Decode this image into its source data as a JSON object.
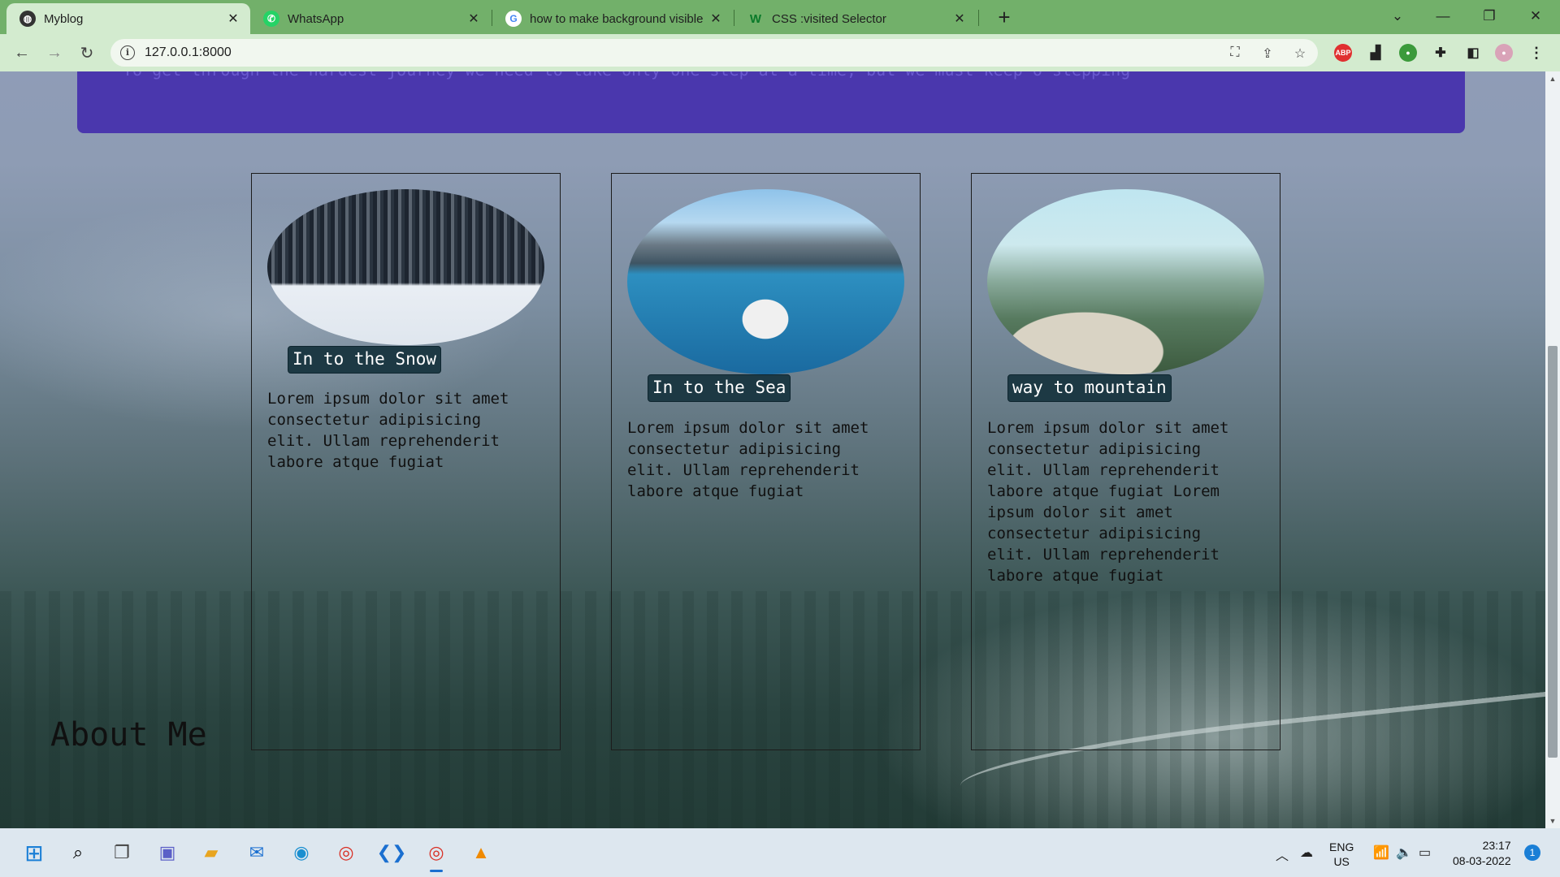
{
  "browser": {
    "tabs": [
      {
        "title": "Myblog",
        "active": true
      },
      {
        "title": "WhatsApp",
        "active": false
      },
      {
        "title": "how to make background visible",
        "active": false
      },
      {
        "title": "CSS :visited Selector",
        "active": false
      }
    ],
    "url": "127.0.0.1:8000"
  },
  "page": {
    "banner_text": "To get through the hardest journey we need to take only one step at a time, but we must keep o stepping",
    "cards": [
      {
        "title": "In to the Snow",
        "text": "Lorem ipsum dolor sit amet consectetur adipisicing elit. Ullam reprehenderit labore atque fugiat"
      },
      {
        "title": "In to the Sea",
        "text": "Lorem ipsum dolor sit amet consectetur adipisicing elit. Ullam reprehenderit labore atque fugiat"
      },
      {
        "title": "way to mountain",
        "text": "Lorem ipsum dolor sit amet consectetur adipisicing elit. Ullam reprehenderit labore atque fugiat Lorem ipsum dolor sit amet consectetur adipisicing elit. Ullam reprehenderit labore atque fugiat"
      }
    ],
    "about_heading": "About Me"
  },
  "taskbar": {
    "lang_line1": "ENG",
    "lang_line2": "US",
    "time": "23:17",
    "date": "08-03-2022",
    "notification_count": "1"
  },
  "colors": {
    "tabstrip": "#72b06a",
    "toolbar": "#d3ebcf",
    "banner": "#4a37ad",
    "badge": "#1d3944"
  }
}
